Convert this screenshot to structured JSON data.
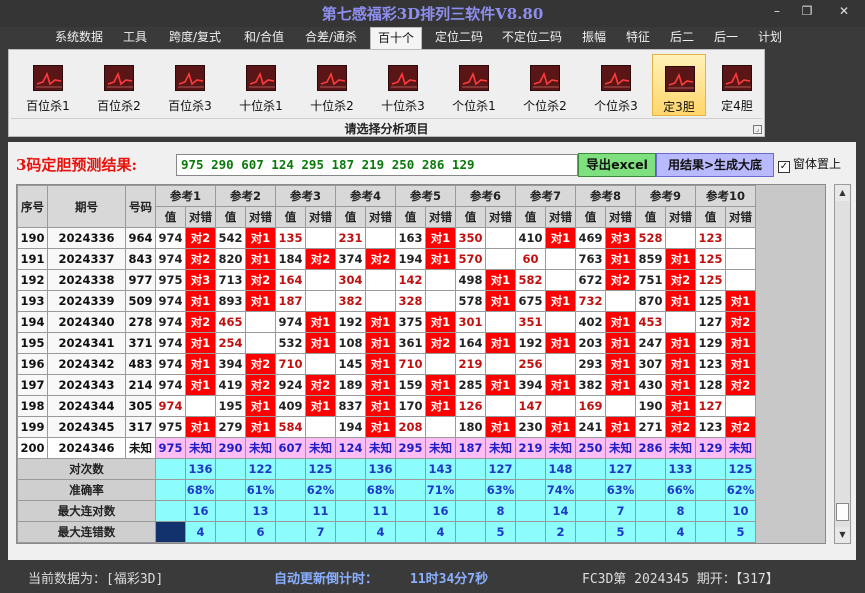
{
  "window": {
    "title": "第七感福彩3D排列三软件V8.80",
    "minimize": "–",
    "restore": "❐",
    "close": "✕"
  },
  "menu": [
    {
      "label": "系统数据"
    },
    {
      "label": "工具"
    },
    {
      "label": "跨度/复式"
    },
    {
      "label": "和/合值"
    },
    {
      "label": "合差/通杀"
    },
    {
      "label": "百十个"
    },
    {
      "label": "定位二码"
    },
    {
      "label": "不定位二码"
    },
    {
      "label": "振幅"
    },
    {
      "label": "特征"
    },
    {
      "label": "后二"
    },
    {
      "label": "后一"
    },
    {
      "label": "计划"
    }
  ],
  "ribbon": {
    "caption": "请选择分析项目",
    "buttons": [
      {
        "label": "百位杀1"
      },
      {
        "label": "百位杀2"
      },
      {
        "label": "百位杀3"
      },
      {
        "label": "十位杀1"
      },
      {
        "label": "十位杀2"
      },
      {
        "label": "十位杀3"
      },
      {
        "label": "个位杀1"
      },
      {
        "label": "个位杀2"
      },
      {
        "label": "个位杀3"
      },
      {
        "label": "定3胆"
      },
      {
        "label": "定4胆"
      }
    ]
  },
  "prediction": {
    "label": "3码定胆预测结果:",
    "values": "975  290  607  124  295  187  219  250  286  129",
    "export_button": "导出excel",
    "use_button": "用结果>生成大底",
    "topmost_checkbox": "窗体置上",
    "topmost_checked": "✓"
  },
  "table": {
    "header": {
      "seq": "序号",
      "issue": "期号",
      "code": "号码",
      "refs": [
        "参考1",
        "参考2",
        "参考3",
        "参考4",
        "参考5",
        "参考6",
        "参考7",
        "参考8",
        "参考9",
        "参考10"
      ],
      "val": "值",
      "hit": "对错"
    },
    "rows": [
      {
        "seq": "190",
        "issue": "2024336",
        "code": "964",
        "cells": [
          [
            "974",
            "对2",
            ""
          ],
          [
            "542",
            "对1",
            ""
          ],
          [
            "135",
            "",
            ""
          ],
          [
            "231",
            "",
            ""
          ],
          [
            "163",
            "对1",
            ""
          ],
          [
            "350",
            "",
            ""
          ],
          [
            "410",
            "对1",
            ""
          ],
          [
            "469",
            "对3",
            ""
          ],
          [
            "528",
            "",
            ""
          ],
          [
            "123",
            "",
            ""
          ]
        ],
        "miss": [
          2,
          3,
          5,
          8,
          9
        ]
      },
      {
        "seq": "191",
        "issue": "2024337",
        "code": "843",
        "cells": [
          [
            "974",
            "对2",
            ""
          ],
          [
            "820",
            "对1",
            ""
          ],
          [
            "184",
            "对2",
            ""
          ],
          [
            "374",
            "对2",
            ""
          ],
          [
            "194",
            "对1",
            ""
          ],
          [
            "570",
            "",
            ""
          ],
          [
            "60",
            "",
            ""
          ],
          [
            "763",
            "对1",
            ""
          ],
          [
            "859",
            "对1",
            ""
          ],
          [
            "125",
            "",
            ""
          ]
        ],
        "miss": [
          5,
          6,
          9
        ]
      },
      {
        "seq": "192",
        "issue": "2024338",
        "code": "977",
        "cells": [
          [
            "975",
            "对3",
            ""
          ],
          [
            "713",
            "对2",
            ""
          ],
          [
            "164",
            "",
            ""
          ],
          [
            "304",
            "",
            ""
          ],
          [
            "142",
            "",
            ""
          ],
          [
            "498",
            "对1",
            ""
          ],
          [
            "582",
            "",
            ""
          ],
          [
            "672",
            "对2",
            ""
          ],
          [
            "751",
            "对2",
            ""
          ],
          [
            "125",
            "",
            ""
          ]
        ],
        "miss": [
          2,
          3,
          4,
          6,
          9
        ]
      },
      {
        "seq": "193",
        "issue": "2024339",
        "code": "509",
        "cells": [
          [
            "974",
            "对1",
            ""
          ],
          [
            "893",
            "对1",
            ""
          ],
          [
            "187",
            "",
            ""
          ],
          [
            "382",
            "",
            ""
          ],
          [
            "328",
            "",
            ""
          ],
          [
            "578",
            "对1",
            ""
          ],
          [
            "675",
            "对1",
            ""
          ],
          [
            "732",
            "",
            ""
          ],
          [
            "870",
            "对1",
            ""
          ],
          [
            "125",
            "对1",
            ""
          ]
        ],
        "miss": [
          2,
          3,
          4,
          7
        ]
      },
      {
        "seq": "194",
        "issue": "2024340",
        "code": "278",
        "cells": [
          [
            "974",
            "对2",
            ""
          ],
          [
            "465",
            "",
            ""
          ],
          [
            "974",
            "对1",
            ""
          ],
          [
            "192",
            "对1",
            ""
          ],
          [
            "375",
            "对1",
            ""
          ],
          [
            "301",
            "",
            ""
          ],
          [
            "351",
            "",
            ""
          ],
          [
            "402",
            "对1",
            ""
          ],
          [
            "453",
            "",
            ""
          ],
          [
            "127",
            "对2",
            ""
          ]
        ],
        "miss": [
          1,
          5,
          6,
          8
        ]
      },
      {
        "seq": "195",
        "issue": "2024341",
        "code": "371",
        "cells": [
          [
            "974",
            "对1",
            ""
          ],
          [
            "254",
            "",
            ""
          ],
          [
            "532",
            "对1",
            ""
          ],
          [
            "108",
            "对1",
            ""
          ],
          [
            "361",
            "对2",
            ""
          ],
          [
            "164",
            "对1",
            ""
          ],
          [
            "192",
            "对1",
            ""
          ],
          [
            "203",
            "对1",
            ""
          ],
          [
            "247",
            "对1",
            ""
          ],
          [
            "129",
            "对1",
            ""
          ]
        ],
        "miss": [
          1
        ]
      },
      {
        "seq": "196",
        "issue": "2024342",
        "code": "483",
        "cells": [
          [
            "974",
            "对1",
            ""
          ],
          [
            "394",
            "对2",
            ""
          ],
          [
            "710",
            "",
            ""
          ],
          [
            "145",
            "对1",
            ""
          ],
          [
            "710",
            "",
            ""
          ],
          [
            "219",
            "",
            ""
          ],
          [
            "256",
            "",
            ""
          ],
          [
            "293",
            "对1",
            ""
          ],
          [
            "307",
            "对1",
            ""
          ],
          [
            "123",
            "对1",
            ""
          ]
        ],
        "miss": [
          2,
          4,
          5,
          6
        ]
      },
      {
        "seq": "197",
        "issue": "2024343",
        "code": "214",
        "cells": [
          [
            "974",
            "对1",
            ""
          ],
          [
            "419",
            "对2",
            ""
          ],
          [
            "924",
            "对2",
            ""
          ],
          [
            "189",
            "对1",
            ""
          ],
          [
            "159",
            "对1",
            ""
          ],
          [
            "285",
            "对1",
            ""
          ],
          [
            "394",
            "对1",
            ""
          ],
          [
            "382",
            "对1",
            ""
          ],
          [
            "430",
            "对1",
            ""
          ],
          [
            "128",
            "对2",
            ""
          ]
        ],
        "miss": []
      },
      {
        "seq": "198",
        "issue": "2024344",
        "code": "305",
        "cells": [
          [
            "974",
            "",
            ""
          ],
          [
            "195",
            "对1",
            ""
          ],
          [
            "409",
            "对1",
            ""
          ],
          [
            "837",
            "对1",
            ""
          ],
          [
            "170",
            "对1",
            ""
          ],
          [
            "126",
            "",
            ""
          ],
          [
            "147",
            "",
            ""
          ],
          [
            "169",
            "",
            ""
          ],
          [
            "190",
            "对1",
            ""
          ],
          [
            "127",
            "",
            ""
          ]
        ],
        "miss": [
          0,
          5,
          6,
          7,
          9
        ]
      },
      {
        "seq": "199",
        "issue": "2024345",
        "code": "317",
        "cells": [
          [
            "975",
            "对1",
            ""
          ],
          [
            "279",
            "对1",
            ""
          ],
          [
            "584",
            "",
            ""
          ],
          [
            "194",
            "对1",
            ""
          ],
          [
            "208",
            "",
            ""
          ],
          [
            "180",
            "对1",
            ""
          ],
          [
            "230",
            "对1",
            ""
          ],
          [
            "241",
            "对1",
            ""
          ],
          [
            "271",
            "对2",
            ""
          ],
          [
            "123",
            "对2",
            ""
          ]
        ],
        "miss": [
          2,
          4
        ]
      },
      {
        "seq": "200",
        "issue": "2024346",
        "code": "未知",
        "cells": [
          [
            "975",
            "未知",
            ""
          ],
          [
            "290",
            "未知",
            ""
          ],
          [
            "607",
            "未知",
            ""
          ],
          [
            "124",
            "未知",
            ""
          ],
          [
            "295",
            "未知",
            ""
          ],
          [
            "187",
            "未知",
            ""
          ],
          [
            "219",
            "未知",
            ""
          ],
          [
            "250",
            "未知",
            ""
          ],
          [
            "286",
            "未知",
            ""
          ],
          [
            "129",
            "未知",
            ""
          ]
        ],
        "miss": []
      }
    ],
    "stats": [
      {
        "label": "对次数",
        "values": [
          "136",
          "122",
          "125",
          "136",
          "143",
          "127",
          "148",
          "127",
          "133",
          "125"
        ]
      },
      {
        "label": "准确率",
        "values": [
          "68%",
          "61%",
          "62%",
          "68%",
          "71%",
          "63%",
          "74%",
          "63%",
          "66%",
          "62%"
        ]
      },
      {
        "label": "最大连对数",
        "values": [
          "16",
          "13",
          "11",
          "11",
          "16",
          "8",
          "14",
          "7",
          "8",
          "10"
        ]
      },
      {
        "label": "最大连错数",
        "values": [
          "4",
          "6",
          "7",
          "4",
          "4",
          "5",
          "2",
          "5",
          "4",
          "5"
        ]
      }
    ]
  },
  "status": {
    "current_data": "当前数据为：[福彩3D]",
    "countdown_label": "自动更新倒计时：",
    "countdown": "11时34分7秒",
    "period": "FC3D第 2024345 期开：【317】"
  }
}
